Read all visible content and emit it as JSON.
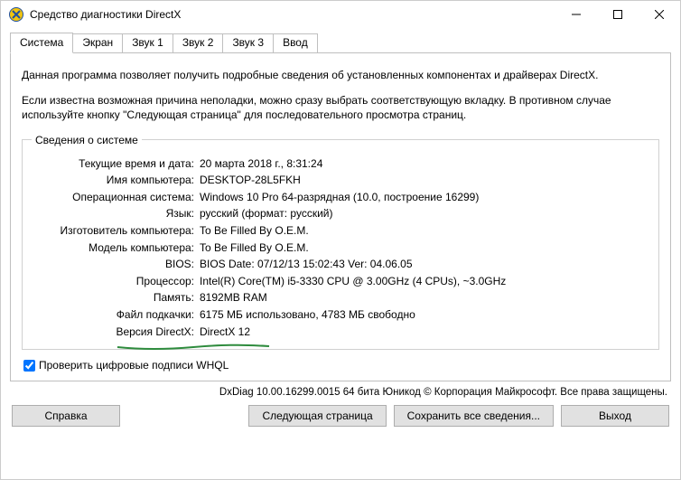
{
  "window": {
    "title": "Средство диагностики DirectX"
  },
  "tabs": [
    "Система",
    "Экран",
    "Звук 1",
    "Звук 2",
    "Звук 3",
    "Ввод"
  ],
  "intro1": "Данная программа позволяет получить подробные сведения об установленных компонентах и драйверах DirectX.",
  "intro2": "Если известна возможная причина неполадки, можно сразу выбрать соответствующую вкладку. В противном случае используйте кнопку \"Следующая страница\" для последовательного просмотра страниц.",
  "group_title": "Сведения о системе",
  "info": [
    {
      "label": "Текущие время и дата:",
      "value": "20 марта 2018 г., 8:31:24"
    },
    {
      "label": "Имя компьютера:",
      "value": "DESKTOP-28L5FKH"
    },
    {
      "label": "Операционная система:",
      "value": "Windows 10 Pro 64-разрядная (10.0, построение 16299)"
    },
    {
      "label": "Язык:",
      "value": "русский (формат: русский)"
    },
    {
      "label": "Изготовитель компьютера:",
      "value": "To Be Filled By O.E.M."
    },
    {
      "label": "Модель компьютера:",
      "value": "To Be Filled By O.E.M."
    },
    {
      "label": "BIOS:",
      "value": "BIOS Date: 07/12/13 15:02:43 Ver: 04.06.05"
    },
    {
      "label": "Процессор:",
      "value": "Intel(R) Core(TM) i5-3330 CPU @ 3.00GHz (4 CPUs), ~3.0GHz"
    },
    {
      "label": "Память:",
      "value": "8192MB RAM"
    },
    {
      "label": "Файл подкачки:",
      "value": "6175 МБ использовано, 4783 МБ свободно"
    },
    {
      "label": "Версия DirectX:",
      "value": "DirectX 12"
    }
  ],
  "whql_label": "Проверить цифровые подписи WHQL",
  "copyright": "DxDiag 10.00.16299.0015 64 бита Юникод © Корпорация Майкрософт. Все права защищены.",
  "buttons": {
    "help": "Справка",
    "next": "Следующая страница",
    "save": "Сохранить все сведения...",
    "exit": "Выход"
  }
}
